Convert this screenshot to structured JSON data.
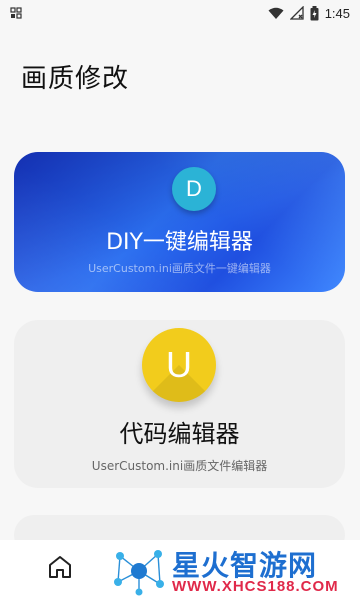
{
  "status_bar": {
    "time": "1:45",
    "icons": [
      "notification-icon",
      "wifi-icon",
      "signal-off-icon",
      "battery-charging-icon"
    ]
  },
  "page": {
    "title": "画质修改"
  },
  "cards": [
    {
      "icon_letter": "D",
      "title": "DIY一键编辑器",
      "subtitle": "UserCustom.ini画质文件一键编辑器",
      "colors": {
        "bg": "#2b6ff0",
        "circle": "#2bb3d6"
      }
    },
    {
      "icon_letter": "U",
      "title": "代码编辑器",
      "subtitle": "UserCustom.ini画质文件编辑器",
      "colors": {
        "bg": "#efefef",
        "circle": "#f2cc1c"
      }
    }
  ],
  "bottom_nav": {
    "items": [
      "home-icon"
    ]
  },
  "watermark": {
    "title": "星火智游网",
    "url": "WWW.XHCS188.COM"
  }
}
